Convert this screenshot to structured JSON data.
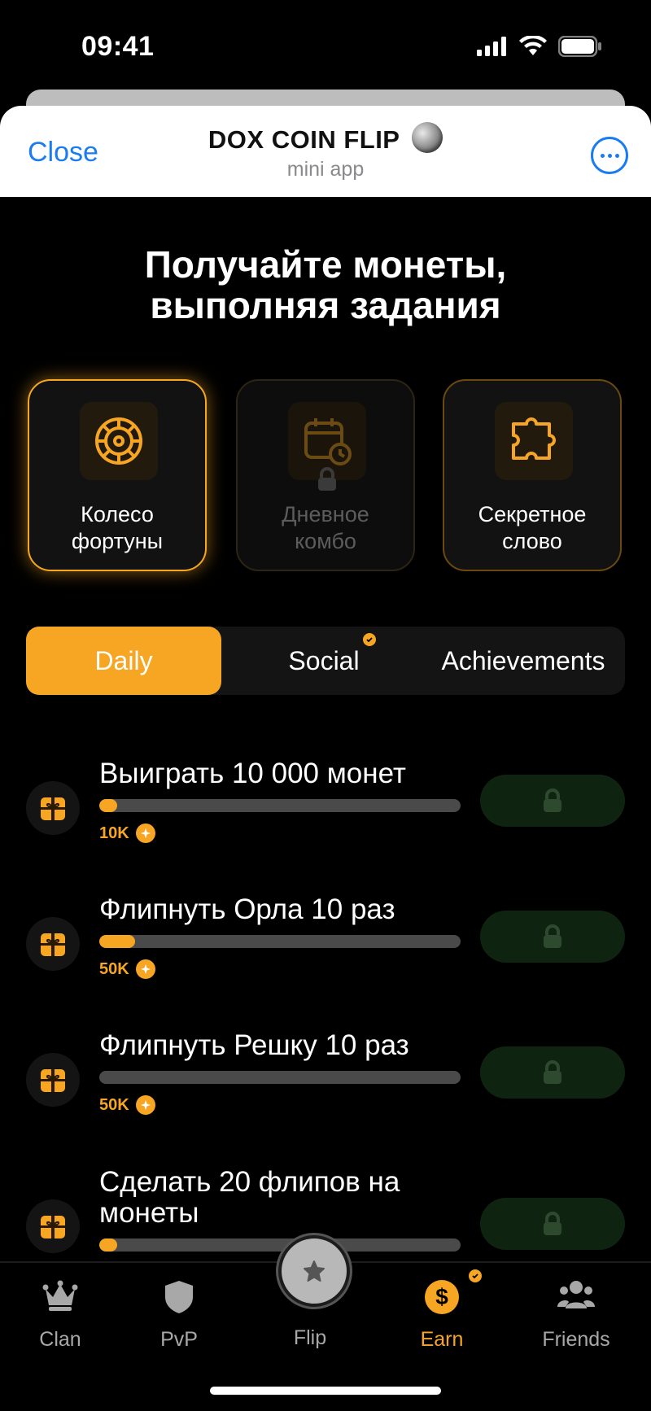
{
  "status_bar": {
    "time": "09:41"
  },
  "header": {
    "close_label": "Close",
    "title": "DOX COIN FLIP",
    "subtitle": "mini app"
  },
  "heading": {
    "line1": "Получайте монеты,",
    "line2": "выполняя задания"
  },
  "feature_cards": [
    {
      "label_line1": "Колесо",
      "label_line2": "фортуны",
      "icon": "roulette-wheel-icon",
      "state": "active"
    },
    {
      "label_line1": "Дневное",
      "label_line2": "комбо",
      "icon": "calendar-clock-icon",
      "state": "locked"
    },
    {
      "label_line1": "Секретное",
      "label_line2": "слово",
      "icon": "puzzle-icon",
      "state": "normal"
    }
  ],
  "tabs": [
    {
      "label": "Daily",
      "active": true
    },
    {
      "label": "Social",
      "active": false,
      "badge": true
    },
    {
      "label": "Achievements",
      "active": false
    }
  ],
  "tasks": [
    {
      "title": "Выиграть 10 000 монет",
      "reward": "10K",
      "progress": 0.05
    },
    {
      "title": "Флипнуть Орла 10 раз",
      "reward": "50K",
      "progress": 0.1
    },
    {
      "title": "Флипнуть Решку 10 раз",
      "reward": "50K",
      "progress": 0.0
    },
    {
      "title": "Сделать 20 флипов на монеты",
      "reward": "",
      "progress": 0.05
    }
  ],
  "nav": {
    "clan": "Clan",
    "pvp": "PvP",
    "flip": "Flip",
    "earn": "Earn",
    "friends": "Friends"
  },
  "colors": {
    "accent": "#f6a623",
    "link_blue": "#1a7cf0",
    "claim_bg": "#0f2410"
  }
}
